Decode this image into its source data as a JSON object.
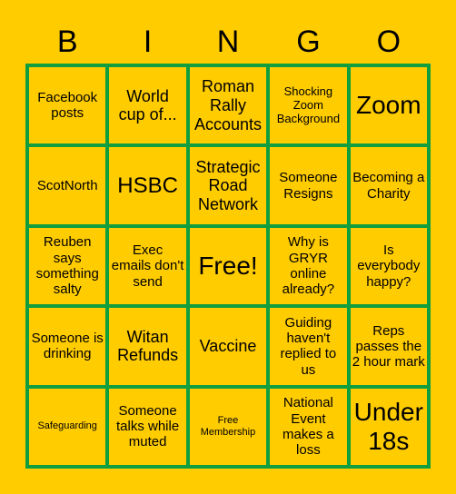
{
  "title_letters": [
    "B",
    "I",
    "N",
    "G",
    "O"
  ],
  "colors": {
    "background": "#FFCC00",
    "grid": "#119E3E",
    "text": "#000000"
  },
  "cells": [
    {
      "text": "Facebook posts",
      "size": "md"
    },
    {
      "text": "World cup of...",
      "size": "lg"
    },
    {
      "text": "Roman Rally Accounts",
      "size": "lg"
    },
    {
      "text": "Shocking Zoom Background",
      "size": "sm"
    },
    {
      "text": "Zoom",
      "size": "xxl"
    },
    {
      "text": "ScotNorth",
      "size": "md"
    },
    {
      "text": "HSBC",
      "size": "xl"
    },
    {
      "text": "Strategic Road Network",
      "size": "lg"
    },
    {
      "text": "Someone Resigns",
      "size": "md"
    },
    {
      "text": "Becoming a Charity",
      "size": "md"
    },
    {
      "text": "Reuben says something salty",
      "size": "md"
    },
    {
      "text": "Exec emails don't send",
      "size": "md"
    },
    {
      "text": "Free!",
      "size": "xxl"
    },
    {
      "text": "Why is GRYR online already?",
      "size": "md"
    },
    {
      "text": "Is everybody happy?",
      "size": "md"
    },
    {
      "text": "Someone is drinking",
      "size": "md"
    },
    {
      "text": "Witan Refunds",
      "size": "lg"
    },
    {
      "text": "Vaccine",
      "size": "lg"
    },
    {
      "text": "Guiding haven't replied to us",
      "size": "md"
    },
    {
      "text": "Reps passes the 2 hour mark",
      "size": "md"
    },
    {
      "text": "Safeguarding",
      "size": "xs"
    },
    {
      "text": "Someone talks while muted",
      "size": "md"
    },
    {
      "text": "Free Membership",
      "size": "xs"
    },
    {
      "text": "National Event makes a loss",
      "size": "md"
    },
    {
      "text": "Under 18s",
      "size": "xxl"
    }
  ]
}
